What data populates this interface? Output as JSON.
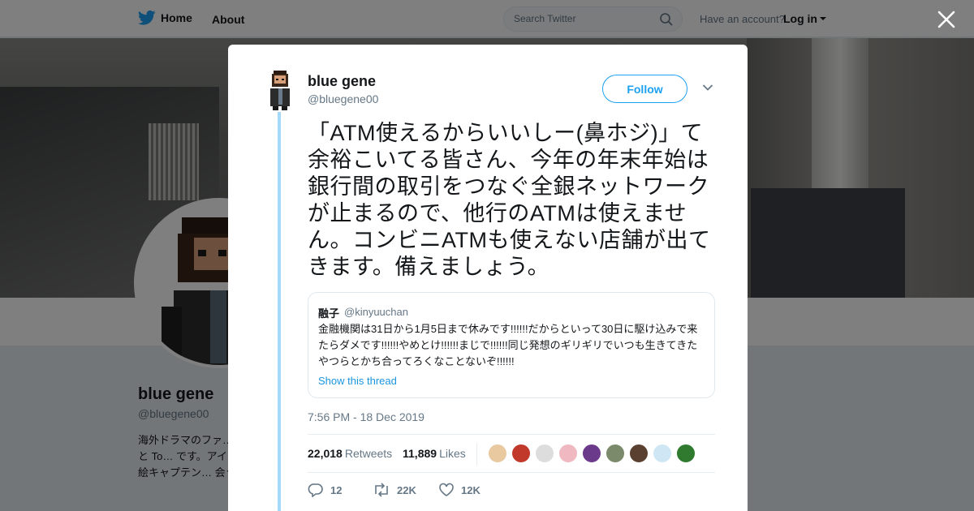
{
  "nav": {
    "home": "Home",
    "about": "About",
    "search_placeholder": "Search Twitter",
    "have_account": "Have an account?",
    "login": "Log in"
  },
  "profile": {
    "name": "blue gene",
    "handle": "@bluegene00",
    "bio": "海外ドラマのファ… Doctor Who と To… です。アイコンは… ット絵キャプテン… 会う人が増えたの"
  },
  "tweet": {
    "author_name": "blue gene",
    "author_handle": "@bluegene00",
    "follow_label": "Follow",
    "text": "「ATM使えるからいいしー(鼻ホジ)」て余裕こいてる皆さん、今年の年末年始は銀行間の取引をつなぐ全銀ネットワークが止まるので、他行のATMは使えません。コンビニATMも使えない店舗が出てきます。備えましょう。",
    "quote": {
      "name": "融子",
      "handle": "@kinyuuchan",
      "text": "金融機関は31日から1月5日まで休みです!!!!!!だからといって30日に駆け込みで来たらダメです!!!!!!やめとけ!!!!!!まじで!!!!!!同じ発想のギリギリでいつも生きてきたやつらとかち合ってろくなことないぞ!!!!!!",
      "show_thread": "Show this thread"
    },
    "timestamp": "7:56 PM - 18 Dec 2019",
    "retweets_count": "22,018",
    "retweets_label": "Retweets",
    "likes_count": "11,889",
    "likes_label": "Likes",
    "reply_count": "12",
    "retweet_short": "22K",
    "like_short": "12K",
    "liker_avatar_colors": [
      "#e8c9a0",
      "#c0392b",
      "#ddd",
      "#f0b8c0",
      "#6b3a8a",
      "#7a8a6a",
      "#5a4030",
      "#cfe6f5",
      "#2f7a2f"
    ]
  },
  "colors": {
    "accent": "#1da1f2",
    "thread_line": "#a4d9f9"
  }
}
